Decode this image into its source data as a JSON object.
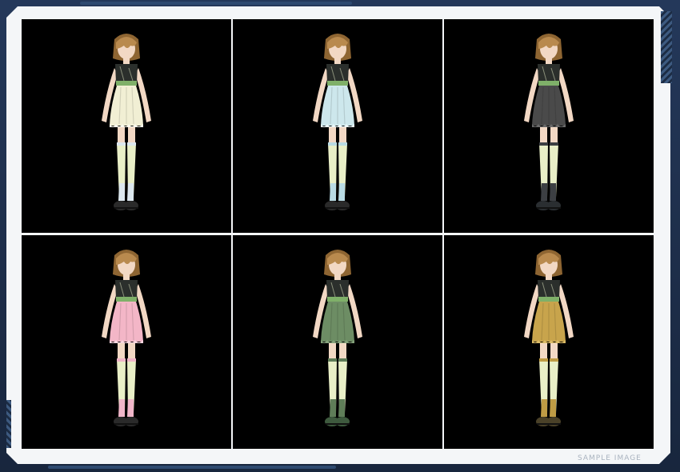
{
  "watermark": "SAMPLE IMAGE",
  "variants": [
    {
      "color": "cream",
      "dress": "#f1efd4",
      "trim": "#fbfaf0",
      "sock": "#dce7ee",
      "shoe": "#2a2a2a"
    },
    {
      "color": "light-blue",
      "dress": "#cde7ec",
      "trim": "#eef9fb",
      "sock": "#b9dbe4",
      "shoe": "#2a2a2a"
    },
    {
      "color": "gray",
      "dress": "#4a4a4a",
      "trim": "#6a6a6a",
      "sock": "#3c3f43",
      "shoe": "#2a2e31"
    },
    {
      "color": "pink",
      "dress": "#f3b6c7",
      "trim": "#fbd8e2",
      "sock": "#f0b6c9",
      "shoe": "#2a2a2a"
    },
    {
      "color": "green",
      "dress": "#6d8d64",
      "trim": "#86a37c",
      "sock": "#5f7d58",
      "shoe": "#3e5a3e"
    },
    {
      "color": "mustard",
      "dress": "#c8a44c",
      "trim": "#dcbc68",
      "sock": "#bf9c45",
      "shoe": "#4a4128"
    }
  ]
}
